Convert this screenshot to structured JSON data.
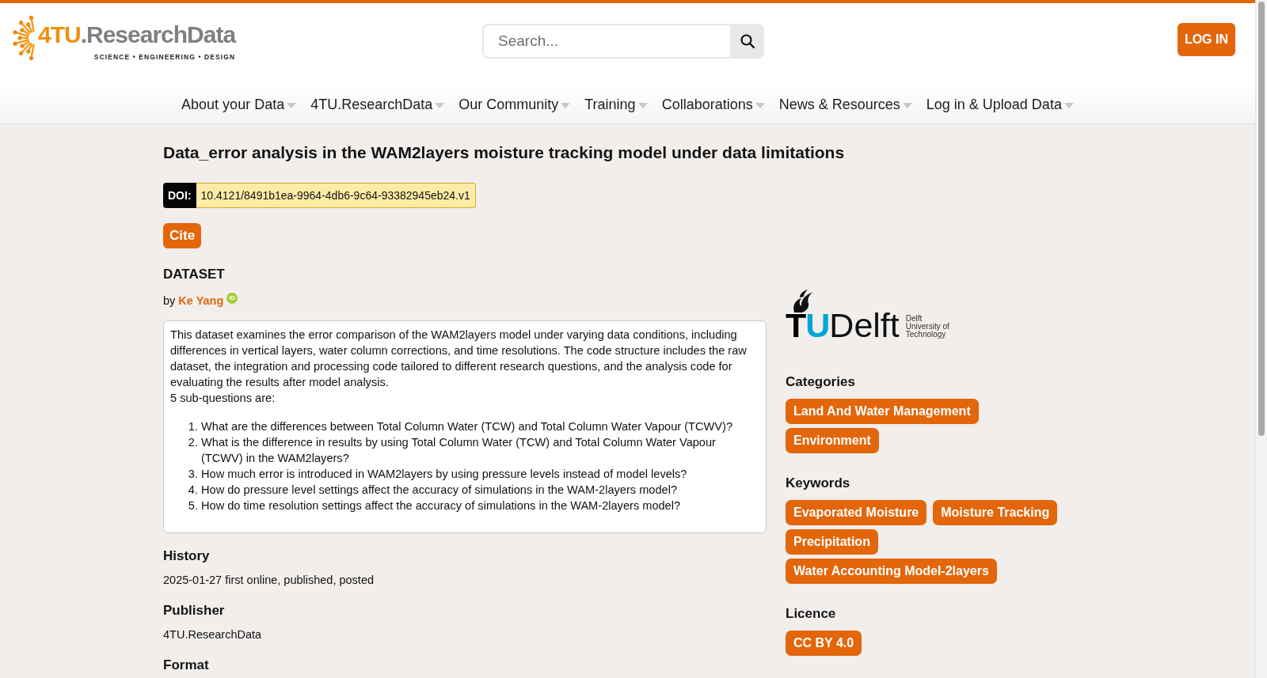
{
  "header": {
    "logo": {
      "prefix": "4TU",
      "name": ".ResearchData",
      "tagline": "SCIENCE • ENGINEERING • DESIGN"
    },
    "search": {
      "placeholder": "Search..."
    },
    "login_button": "LOG IN"
  },
  "nav": [
    {
      "label": "About your Data",
      "dropdown": true
    },
    {
      "label": "4TU.ResearchData",
      "dropdown": true
    },
    {
      "label": "Our Community",
      "dropdown": true
    },
    {
      "label": "Training",
      "dropdown": true
    },
    {
      "label": "Collaborations",
      "dropdown": true
    },
    {
      "label": "News & Resources",
      "dropdown": true
    },
    {
      "label": "Log in & Upload Data",
      "dropdown": true
    }
  ],
  "dataset": {
    "title": "Data_error analysis in the WAM2layers moisture tracking model under data limitations",
    "doi": {
      "label": "DOI:",
      "value": "10.4121/8491b1ea-9964-4db6-9c64-93382945eb24.v1"
    },
    "cite_button": "Cite",
    "type_label": "DATASET",
    "byline": {
      "prefix": "by",
      "author": "Ke Yang",
      "orcid": "iD"
    },
    "description": {
      "paragraphs": [
        "This dataset examines the error comparison of the WAM2layers model under varying data conditions, including differences in vertical layers, water column corrections, and time resolutions. The code structure includes the raw dataset, the integration and processing code tailored to different research questions, and the analysis code for evaluating the results after model analysis.",
        "5 sub-questions are:"
      ],
      "questions": [
        {
          "number": "1.",
          "text": "What are the differences between Total Column Water (TCW) and Total Column Water Vapour (TCWV)?"
        },
        {
          "number": "2.",
          "text": "What is the difference in results by using Total Column Water (TCW) and Total Column Water Vapour (TCWV) in the WAM2layers?"
        },
        {
          "number": "3.",
          "text": "How much error is introduced in WAM2layers by using pressure levels instead of model levels?"
        },
        {
          "number": "4.",
          "text": "How do pressure level settings affect the accuracy of simulations in the WAM-2layers model?"
        },
        {
          "number": "5.",
          "text": "How do time resolution settings affect the accuracy of simulations in the WAM-2layers model?"
        }
      ]
    },
    "details": [
      {
        "heading": "History",
        "value": "2025-01-27 first online, published, posted"
      },
      {
        "heading": "Publisher",
        "value": "4TU.ResearchData"
      },
      {
        "heading": "Format"
      }
    ]
  },
  "sidebar": {
    "institution_logo": {
      "initial": "T",
      "accent": "U",
      "name": "Delft",
      "caption_lines": [
        "Delft",
        "University of",
        "Technology"
      ]
    },
    "groups": [
      {
        "heading": "Categories",
        "tags": [
          "Land And Water Management",
          "Environment"
        ]
      },
      {
        "heading": "Keywords",
        "tags": [
          "Evaporated Moisture",
          "Moisture Tracking",
          "Precipitation",
          "Water Accounting Model-2layers"
        ]
      },
      {
        "heading": "Licence",
        "tags": [
          "CC BY 4.0"
        ]
      }
    ]
  }
}
